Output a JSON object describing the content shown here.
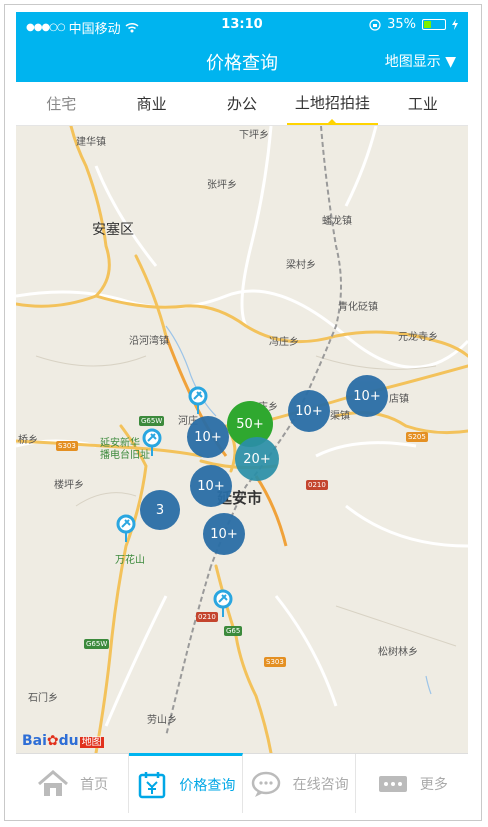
{
  "status": {
    "carrier": "中国移动",
    "time": "13:10",
    "battery": "35%",
    "signal_dots": "●●●○○",
    "battery_level": 0.35
  },
  "nav": {
    "title": "价格查询",
    "map_display": "地图显示 ▼"
  },
  "tabs": [
    {
      "label": "住宅"
    },
    {
      "label": "商业"
    },
    {
      "label": "办公"
    },
    {
      "label": "土地招拍挂",
      "active": true
    },
    {
      "label": "工业"
    }
  ],
  "map": {
    "places": {
      "jianhua": "建华镇",
      "xiapingxiang": "下坪乡",
      "zhangpingxiang": "张坪乡",
      "ansaiqu": "安塞区",
      "panlongzhen": "蟠龙镇",
      "lishunxiang": "梁村乡",
      "qinghuazhen": "青化砭镇",
      "yuanlongsi": "元龙寺乡",
      "yanhezhen": "沿河湾镇",
      "fengzhuangxiang": "冯庄乡",
      "hezhuang": "河庄",
      "qiaoxiang": "桥乡",
      "yanan_xinhua": "延安新华",
      "radio_station": "播电台旧址",
      "gaodian": "店镇",
      "liuzhuang": "庄乡",
      "louping": "楼坪乡",
      "yananshi": "延安市",
      "wanhuashan": "万花山",
      "songshulin": "松树林乡",
      "shimen": "石门乡",
      "laoshan": "劳山乡",
      "wenshang": "渠镇"
    },
    "shields": {
      "g65w_a": "G65W",
      "s303_a": "S303",
      "s205": "S205",
      "g0210_a": "0210",
      "g0210_b": "0210",
      "g65": "G65",
      "g65w_b": "G65W",
      "s303_b": "S303"
    },
    "clusters": [
      {
        "label": "10+"
      },
      {
        "label": "50+"
      },
      {
        "label": "10+"
      },
      {
        "label": "10+"
      },
      {
        "label": "20+"
      },
      {
        "label": "10+"
      },
      {
        "label": "3"
      },
      {
        "label": "10+"
      }
    ],
    "logo": {
      "bai": "Bai",
      "du": "du",
      "tu": "地图"
    }
  },
  "bottom": [
    {
      "label": "首页",
      "icon": "home-icon"
    },
    {
      "label": "价格查询",
      "icon": "price-calendar-icon",
      "active": true
    },
    {
      "label": "在线咨询",
      "icon": "chat-icon"
    },
    {
      "label": "更多",
      "icon": "more-icon"
    }
  ],
  "colors": {
    "primary": "#00b4ef",
    "tab_indicator": "#ffd400",
    "cluster_blue": "#2a6ea6",
    "cluster_green": "#2fa82f"
  }
}
